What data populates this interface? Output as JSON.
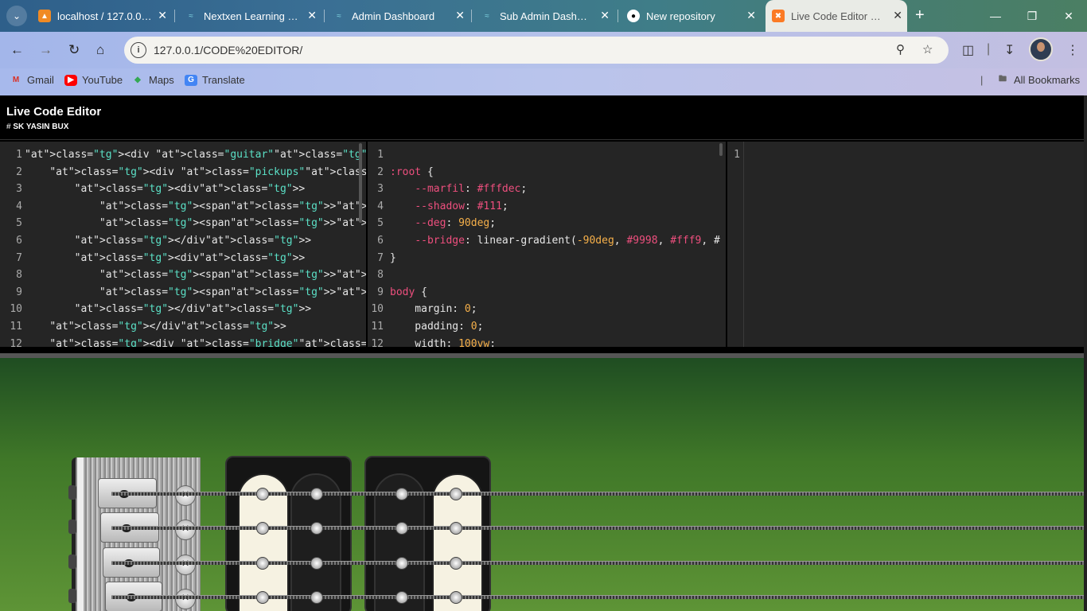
{
  "tabs": [
    {
      "title": "localhost / 127.0.0.1 / ...",
      "favicon": "phpmyadmin-icon"
    },
    {
      "title": "Nextxen Learning :: H...",
      "favicon": "wave-icon"
    },
    {
      "title": "Admin Dashboard",
      "favicon": "wave-icon"
    },
    {
      "title": "Sub Admin Dashboard",
      "favicon": "wave-icon"
    },
    {
      "title": "New repository",
      "favicon": "github-icon"
    },
    {
      "title": "Live Code Editor | Yas...",
      "favicon": "xampp-icon",
      "active": true
    }
  ],
  "address": {
    "url": "127.0.0.1/CODE%20EDITOR/"
  },
  "bookmarks": {
    "items": [
      {
        "label": "Gmail",
        "icon": "gmail-icon"
      },
      {
        "label": "YouTube",
        "icon": "youtube-icon"
      },
      {
        "label": "Maps",
        "icon": "maps-icon"
      },
      {
        "label": "Translate",
        "icon": "translate-icon"
      }
    ],
    "all_label": "All Bookmarks"
  },
  "app": {
    "title": "Live Code Editor",
    "subtitle_prefix": "#",
    "subtitle": "SK YASIN BUX"
  },
  "html_editor": {
    "line_numbers": [
      "1",
      "2",
      "3",
      "4",
      "5",
      "6",
      "7",
      "8",
      "9",
      "10",
      "11",
      "12"
    ],
    "lines": [
      "<div class=\"guitar\">",
      "    <div class=\"pickups\">",
      "        <div>",
      "            <span></span>",
      "            <span></span>",
      "        </div>",
      "        <div>",
      "            <span></span>",
      "            <span></span>",
      "        </div>",
      "    </div>",
      "    <div class=\"bridge\">"
    ]
  },
  "css_editor": {
    "line_numbers": [
      "1",
      "2",
      "3",
      "4",
      "5",
      "6",
      "7",
      "8",
      "9",
      "10",
      "11",
      "12"
    ],
    "lines": [
      "",
      ":root {",
      "    --marfil: #fffdec;",
      "    --shadow: #111;",
      "    --deg: 90deg;",
      "    --bridge: linear-gradient(-90deg, #9998, #fff9, #",
      "}",
      "",
      "body {",
      "    margin: 0;",
      "    padding: 0;",
      "    width: 100vw;"
    ]
  },
  "js_editor": {
    "line_numbers": [
      "1"
    ],
    "lines": [
      ""
    ]
  },
  "colors": {
    "tag": "#ee4f7e",
    "string": "#5be0c6",
    "number": "#f6b04a",
    "editor_bg": "#252525"
  }
}
